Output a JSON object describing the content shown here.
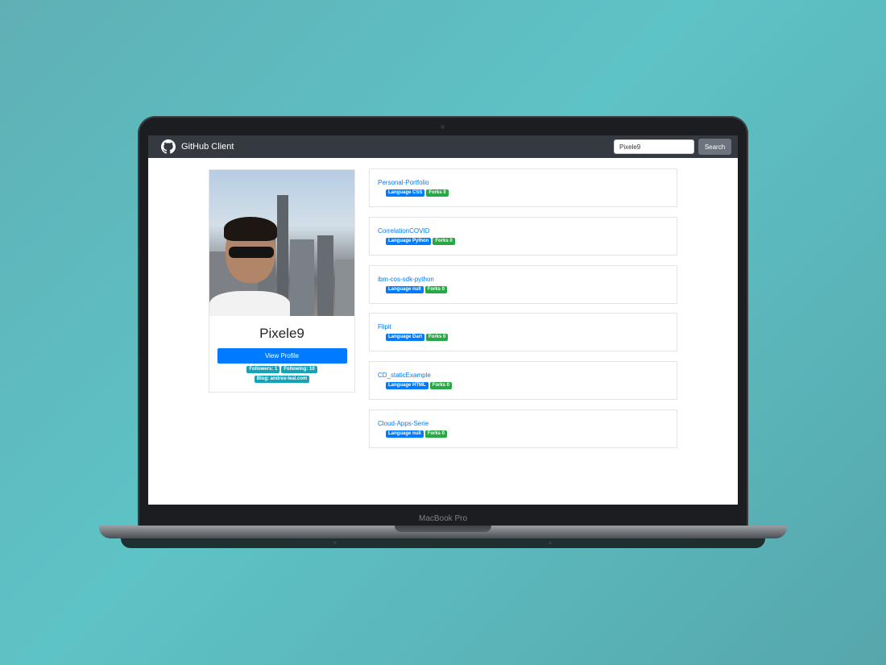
{
  "device": {
    "label": "MacBook Pro"
  },
  "navbar": {
    "brand_icon": "github-icon",
    "brand_text": "GitHub Client",
    "search_value": "Pixele9",
    "search_button": "Search"
  },
  "profile": {
    "avatar_icon": "avatar-photo",
    "username": "Pixele9",
    "view_profile_label": "View Profile",
    "followers": "Followers: 1",
    "following": "Following: 10",
    "blog": "Blog: andres-leal.com"
  },
  "repos": [
    {
      "name": "Personal-Portfolio",
      "language": "Language CSS",
      "forks": "Forks 0"
    },
    {
      "name": "CorrelationCOVID",
      "language": "Language Python",
      "forks": "Forks 0"
    },
    {
      "name": "ibm-cos-sdk-python",
      "language": "Language null",
      "forks": "Forks 0"
    },
    {
      "name": "Flipit",
      "language": "Language Dart",
      "forks": "Forks 0"
    },
    {
      "name": "CD_staticExample",
      "language": "Language HTML",
      "forks": "Forks 0"
    },
    {
      "name": "Cloud-Apps-Serie",
      "language": "Language null",
      "forks": "Forks 0"
    }
  ],
  "colors": {
    "navbar": "#343a40",
    "primary": "#007bff",
    "info": "#17a2b8",
    "success": "#28a745",
    "secondary": "#6c757d",
    "background": "#5fb8bb"
  }
}
